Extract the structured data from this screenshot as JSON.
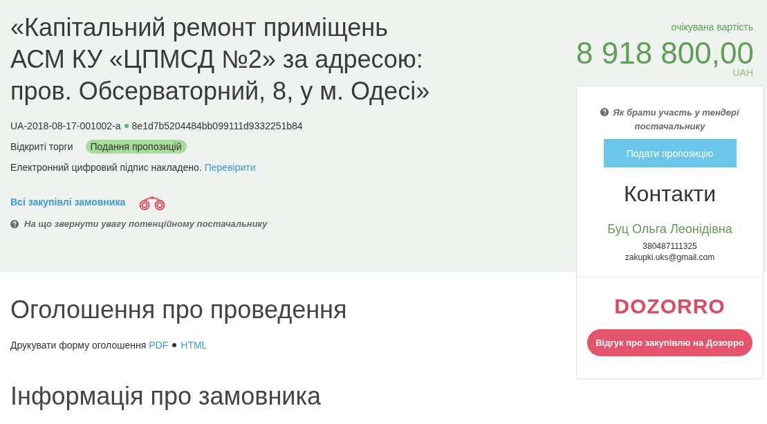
{
  "tender": {
    "title": "«Капітальний ремонт приміщень АСМ КУ «ЦПМСД №2» за адресою: пров. Обсерваторний, 8, у м. Одесі»",
    "tender_id": "UA-2018-08-17-001002-a",
    "hash": "8e1d7b5204484bb099111d9332251b84",
    "procedure": "Відкриті торги",
    "status_badge": "Подання пропозицій",
    "signature_note": "Електронний цифровий підпис накладено.",
    "signature_link": "Перевірити",
    "buyer_link": "Всі закупівлі замовника",
    "hint_link": "На що звернути увагу потенційному постачальнику"
  },
  "price": {
    "label": "очікувана вартість",
    "amount": "8 918 800,00",
    "currency": "UAH"
  },
  "sidebar": {
    "help_link": "Як брати участь у тендері постачальнику",
    "submit_button": "Подати пропозицію",
    "contacts": {
      "heading": "Контакти",
      "name": "Буц Ольга Леонідівна",
      "phone": "380487111325",
      "email": "zakupki.uks@gmail.com"
    },
    "dozorro": {
      "logo": "DOZORRO",
      "button": "Відгук про закупівлю на Дозорро"
    }
  },
  "sections": [
    {
      "heading": "Оголошення про проведення",
      "print_label": "Друкувати форму оголошення",
      "print_links": [
        "PDF",
        "HTML"
      ]
    },
    {
      "heading": "Інформація про замовника"
    }
  ]
}
